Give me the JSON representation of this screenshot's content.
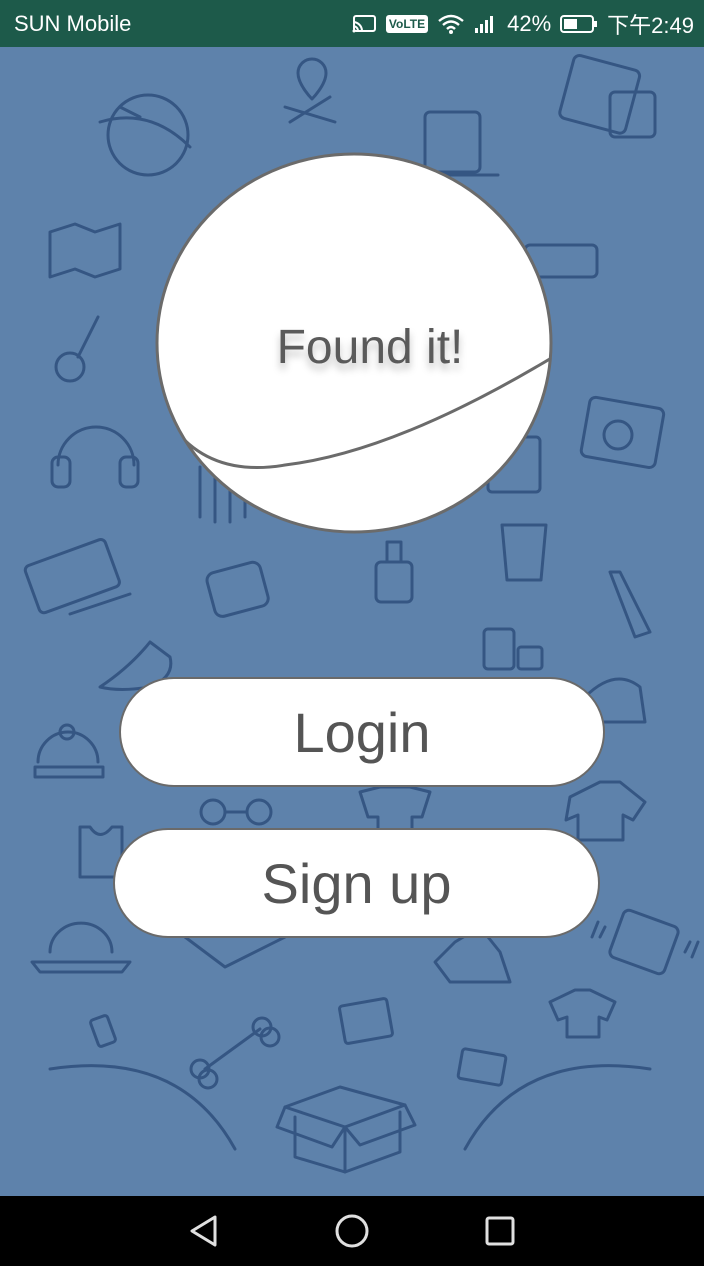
{
  "status_bar": {
    "carrier": "SUN Mobile",
    "volte": "VoLTE",
    "battery_percent": "42%",
    "time": "下午2:49",
    "icons": [
      "cast-icon",
      "volte-icon",
      "wifi-icon",
      "signal-icon",
      "battery-icon"
    ]
  },
  "logo": {
    "text": "Found it!"
  },
  "buttons": {
    "login": "Login",
    "signup": "Sign up"
  },
  "nav_bar": {
    "icons": [
      "back-icon",
      "home-icon",
      "recents-icon"
    ]
  },
  "colors": {
    "background": "#5e82ab",
    "status_bar": "#1d5a4a",
    "doodle_stroke": "#2f4f7c"
  }
}
